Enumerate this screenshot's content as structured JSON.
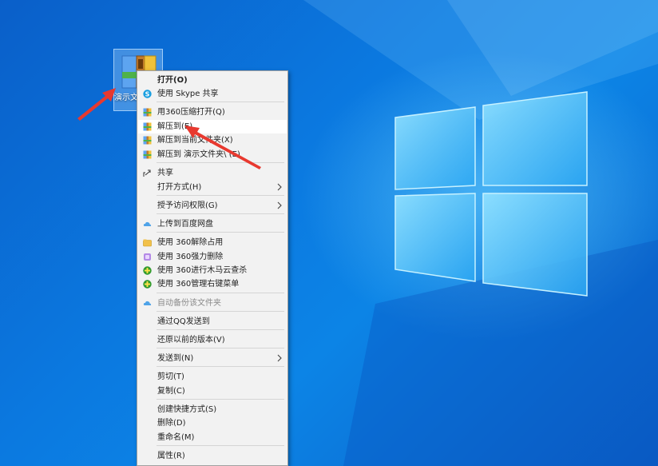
{
  "desktop": {
    "icon_label": "演示文件夹.zip",
    "icon_name": "zip-archive-icon"
  },
  "context_menu": {
    "items": [
      {
        "label": "打开(O)",
        "icon": null,
        "bold": true
      },
      {
        "label": "使用 Skype 共享",
        "icon": "skype-icon"
      },
      {
        "label": "用360压缩打开(Q)",
        "icon": "archive-icon"
      },
      {
        "label": "解压到(E)",
        "icon": "archive-icon",
        "highlighted": true
      },
      {
        "label": "解压到当前文件夹(X)",
        "icon": "archive-icon"
      },
      {
        "label": "解压到 演示文件夹\\ (E)",
        "icon": "archive-icon"
      },
      {
        "label": "共享",
        "icon": "share-icon"
      },
      {
        "label": "打开方式(H)",
        "submenu": true
      },
      {
        "label": "授予访问权限(G)",
        "submenu": true
      },
      {
        "label": "上传到百度网盘",
        "icon": "baidu-cloud-icon"
      },
      {
        "label": "使用 360解除占用",
        "icon": "folder-unlock-icon"
      },
      {
        "label": "使用 360强力删除",
        "icon": "shred-icon"
      },
      {
        "label": "使用 360进行木马云查杀",
        "icon": "360-icon"
      },
      {
        "label": "使用 360管理右键菜单",
        "icon": "360-icon"
      },
      {
        "label": "自动备份该文件夹",
        "icon": "baidu-cloud-icon",
        "disabled": true
      },
      {
        "label": "通过QQ发送到"
      },
      {
        "label": "还原以前的版本(V)"
      },
      {
        "label": "发送到(N)",
        "submenu": true
      },
      {
        "label": "剪切(T)"
      },
      {
        "label": "复制(C)"
      },
      {
        "label": "创建快捷方式(S)"
      },
      {
        "label": "删除(D)"
      },
      {
        "label": "重命名(M)"
      },
      {
        "label": "属性(R)"
      }
    ]
  },
  "colors": {
    "desktop_blue": "#0b79e0",
    "menu_bg": "#f2f2f2",
    "highlight_bg": "#ffffff",
    "annotation_red": "#e8392f"
  }
}
